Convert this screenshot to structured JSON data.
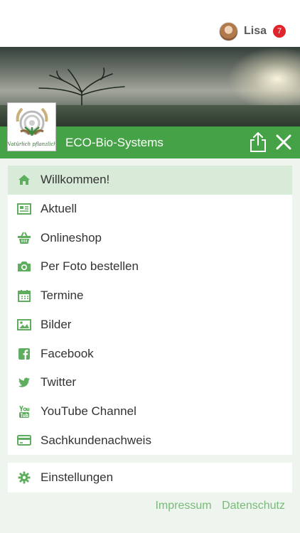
{
  "user": {
    "name": "Lisa",
    "notifications": "7"
  },
  "header": {
    "title": "ECO-Bio-Systems",
    "logo_text": "Natürlich pflanzlich"
  },
  "menu": {
    "items": [
      {
        "label": "Willkommen!",
        "icon": "home-icon",
        "active": true
      },
      {
        "label": "Aktuell",
        "icon": "newspaper-icon"
      },
      {
        "label": "Onlineshop",
        "icon": "basket-icon"
      },
      {
        "label": "Per Foto bestellen",
        "icon": "camera-icon"
      },
      {
        "label": "Termine",
        "icon": "calendar-icon"
      },
      {
        "label": "Bilder",
        "icon": "image-icon"
      },
      {
        "label": "Facebook",
        "icon": "facebook-icon"
      },
      {
        "label": "Twitter",
        "icon": "twitter-icon"
      },
      {
        "label": "YouTube Channel",
        "icon": "youtube-icon"
      },
      {
        "label": "Sachkundenachweis",
        "icon": "credit-card-icon"
      }
    ],
    "settings": {
      "label": "Einstellungen",
      "icon": "gear-icon"
    }
  },
  "footer": {
    "impressum": "Impressum",
    "datenschutz": "Datenschutz"
  },
  "colors": {
    "accent": "#46a247",
    "icon": "#5fae5f",
    "active_bg": "#d8ead8",
    "badge": "#e0242b",
    "background": "#eef5ee"
  }
}
